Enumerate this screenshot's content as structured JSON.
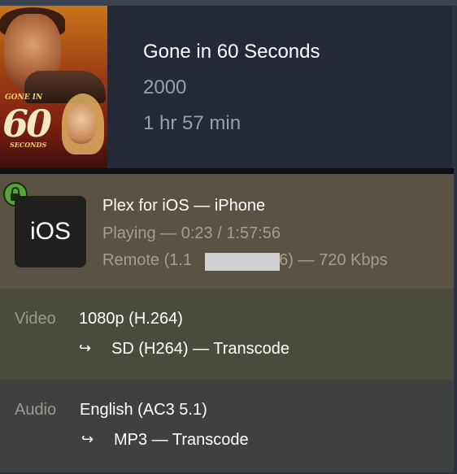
{
  "movie": {
    "poster_text_top": "GONE IN",
    "poster_text_big": "60",
    "poster_text_bottom": "SECONDS",
    "title": "Gone in 60 Seconds",
    "year": "2000",
    "duration": "1 hr 57 min"
  },
  "player": {
    "lock_icon": "lock-icon",
    "platform_badge": "iOS",
    "device_line": "Plex for iOS  —  iPhone",
    "status_line": "Playing — 0:23 / 1:57:56",
    "remote_prefix": "Remote (1.1",
    "remote_suffix": "46) — 720 Kbps",
    "lock_color": "#56a637"
  },
  "video": {
    "label": "Video",
    "source": "1080p (H.264)",
    "target": "SD (H264) — Transcode",
    "arrow_icon": "return-arrow-icon"
  },
  "audio": {
    "label": "Audio",
    "source": "English (AC3 5.1)",
    "target": "MP3 — Transcode",
    "arrow_icon": "return-arrow-icon"
  }
}
